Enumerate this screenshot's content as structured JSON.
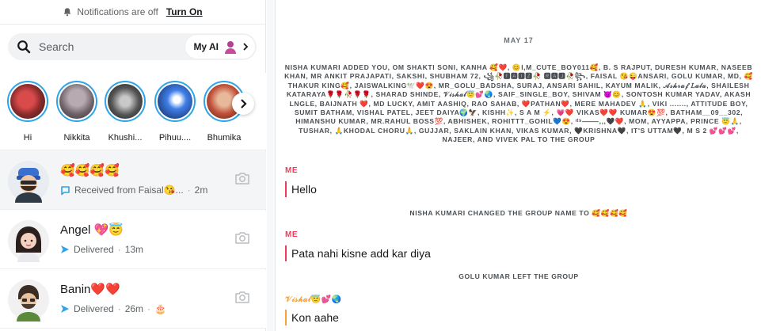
{
  "notifications": {
    "text": "Notifications are off",
    "action": "Turn On"
  },
  "search": {
    "placeholder": "Search",
    "my_ai_label": "My AI"
  },
  "stories": [
    {
      "name": "Hi"
    },
    {
      "name": "Nikkita"
    },
    {
      "name": "Khushi..."
    },
    {
      "name": "Pihuu...."
    },
    {
      "name": "Bhumika"
    }
  ],
  "chats": [
    {
      "name": "🥰🥰🥰🥰",
      "status": "Received from Faisal😘...",
      "time": "2m"
    },
    {
      "name": "Angel 💖😇",
      "status": "Delivered",
      "time": "13m"
    },
    {
      "name": "Banin❤️❤️",
      "status": "Delivered",
      "time": "26m",
      "extra": "🎂"
    }
  ],
  "conversation": {
    "date": "MAY 17",
    "added_notice": "NISHA KUMARI ADDED YOU, OM SHAKTI SONI, KANHA 🥰❤️, 😊I,M_CUTE_BOY011🥰, B. S RAJPUT, DURESH KUMAR, NASEEB KHAN, MR ANKIT PRAJAPATI, SAKSHI, SHUBHAM 72, ꧁🥀🅵🅰🅸🆉🥀 🆁🅰🅹🥀꧂, FAISAL 😘😜ANSARI, GOLU KUMAR, MD, 🥰THAKUR KING🥰, JAISWALKING🕊️❤️😍, MR_GOLU_BADSHA, SURAJ, ANSARI SAHIL, KAYUM MALIK, 𝒜𝓈𝒽𝓇𝒶𝒻 𝐿𝒶𝓁𝒶, SHAILESH KATARAYA🌹🌹🥀🌹🌹, SHARAD SHINDE, 𝒱𝒾𝓈𝒽𝒶𝓁😇💕🌏, SAIF_SINGLE_BOY, SHIVAM 😈😊, SONTOSH KUMAR YADAV, AKASH LNGLE, BAIJNATH ❤️, MD LUCKY, AMIT AASHIQ, RAO SAHAB, ❤️PATHAN❤️, MERE MAHADEV 🙏, VIKI ......., ATTITUDE BOY, SUMIT BATHAM, VISHAL PATEL, JEET DAIYA🌍🦅, KISHH✨, S A M ⚡️, 💗❤️ VIKAS❤️❤️ KUMAR😍💯, BATHAM__09__302, HIMANSHU KUMAR, MR.RAHUL BOSS💯, ABHISHEK, ROHITTT_GOHIL💙😍, ᶦᵗˢ⸻,,,🖤❤️, MOM, AYYAPPA, PRINCE 😇🙏, TUSHAR, 🙏KHODAL CHORU🙏, GUJJAR, SAKLAIN KHAN, VIKAS KUMAR, 🖤KRISHNA🖤, IT'S UTTAM🖤, M S 2 💕💕💕, NAJEER, AND VIVEK PAL TO THE GROUP",
    "messages": [
      {
        "sender": "ME",
        "text": "Hello"
      },
      {
        "system": "NISHA KUMARI CHANGED THE GROUP NAME TO 🥰🥰🥰🥰"
      },
      {
        "sender": "ME",
        "text": "Pata nahi kisne add kar diya"
      },
      {
        "system": "GOLU KUMAR LEFT THE GROUP"
      },
      {
        "sender": "𝒱𝒾𝓈𝒽𝒶𝓁😇💕🌏",
        "text": "Kon aahe"
      }
    ]
  },
  "colors": {
    "story_ring": "#2ea3e6",
    "me_accent": "#f23c57",
    "other_accent": "#f2a33c",
    "delivered_arrow": "#2ea3e6"
  },
  "icons": [
    "bell-slash-icon",
    "search-icon",
    "my-ai-avatar-icon",
    "chevron-right-icon",
    "camera-icon",
    "chat-bubble-icon",
    "delivered-arrow-icon"
  ]
}
